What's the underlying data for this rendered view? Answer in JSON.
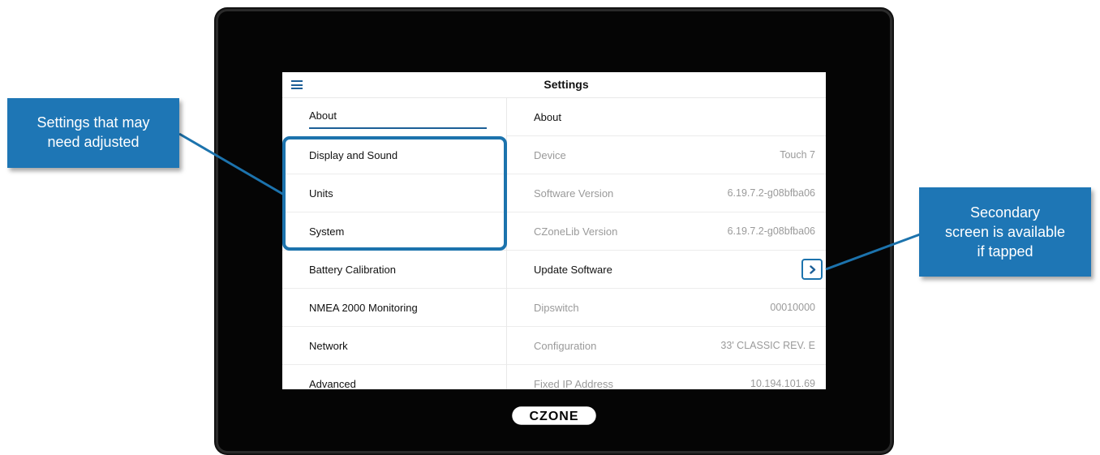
{
  "screen": {
    "title": "Settings"
  },
  "sidebar": {
    "items": [
      {
        "label": "About",
        "active": true
      },
      {
        "label": "Display and Sound"
      },
      {
        "label": "Units"
      },
      {
        "label": "System"
      },
      {
        "label": "Battery Calibration"
      },
      {
        "label": "NMEA 2000 Monitoring"
      },
      {
        "label": "Network"
      },
      {
        "label": "Advanced"
      }
    ]
  },
  "about": {
    "header": "About",
    "rows": [
      {
        "label": "Device",
        "value": "Touch 7"
      },
      {
        "label": "Software Version",
        "value": "6.19.7.2-g08bfba06"
      },
      {
        "label": "CZoneLib Version",
        "value": "6.19.7.2-g08bfba06"
      },
      {
        "label": "Update Software",
        "icon": "chevron-right-icon"
      },
      {
        "label": "Dipswitch",
        "value": "00010000"
      },
      {
        "label": "Configuration",
        "value": "33' CLASSIC REV. E"
      },
      {
        "label": "Fixed IP Address",
        "value": "10.194.101.69"
      }
    ]
  },
  "callouts": {
    "left_line1": "Settings that may",
    "left_line2": "need adjusted",
    "right_line1": "Secondary",
    "right_line2": "screen is available",
    "right_line3": "if tapped"
  },
  "brand": {
    "logo_text": "CZONE"
  },
  "colors": {
    "accent": "#1c5f97",
    "callout": "#1e76b5",
    "bezel": "#050505"
  }
}
